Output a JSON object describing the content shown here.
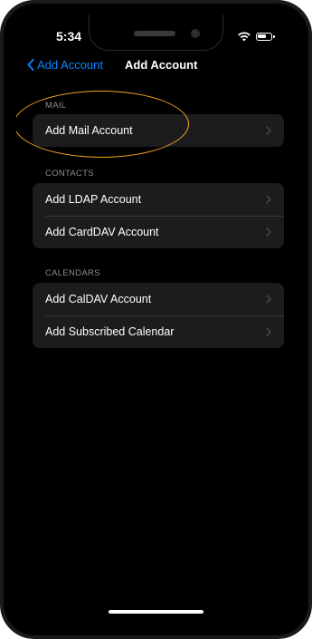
{
  "status_bar": {
    "time": "5:34",
    "icons": [
      "wifi-icon",
      "battery-icon"
    ]
  },
  "nav": {
    "back_label": "Add Account",
    "back_icon": "chevron-left-icon",
    "title": "Add Account"
  },
  "sections": [
    {
      "header": "MAIL",
      "rows": [
        {
          "label": "Add Mail Account"
        }
      ]
    },
    {
      "header": "CONTACTS",
      "rows": [
        {
          "label": "Add LDAP Account"
        },
        {
          "label": "Add CardDAV Account"
        }
      ]
    },
    {
      "header": "CALENDARS",
      "rows": [
        {
          "label": "Add CalDAV Account"
        },
        {
          "label": "Add Subscribed Calendar"
        }
      ]
    }
  ],
  "colors": {
    "accent": "#0a84ff",
    "highlight": "#f5a623",
    "background": "#000000",
    "group_background": "#1c1c1e"
  }
}
